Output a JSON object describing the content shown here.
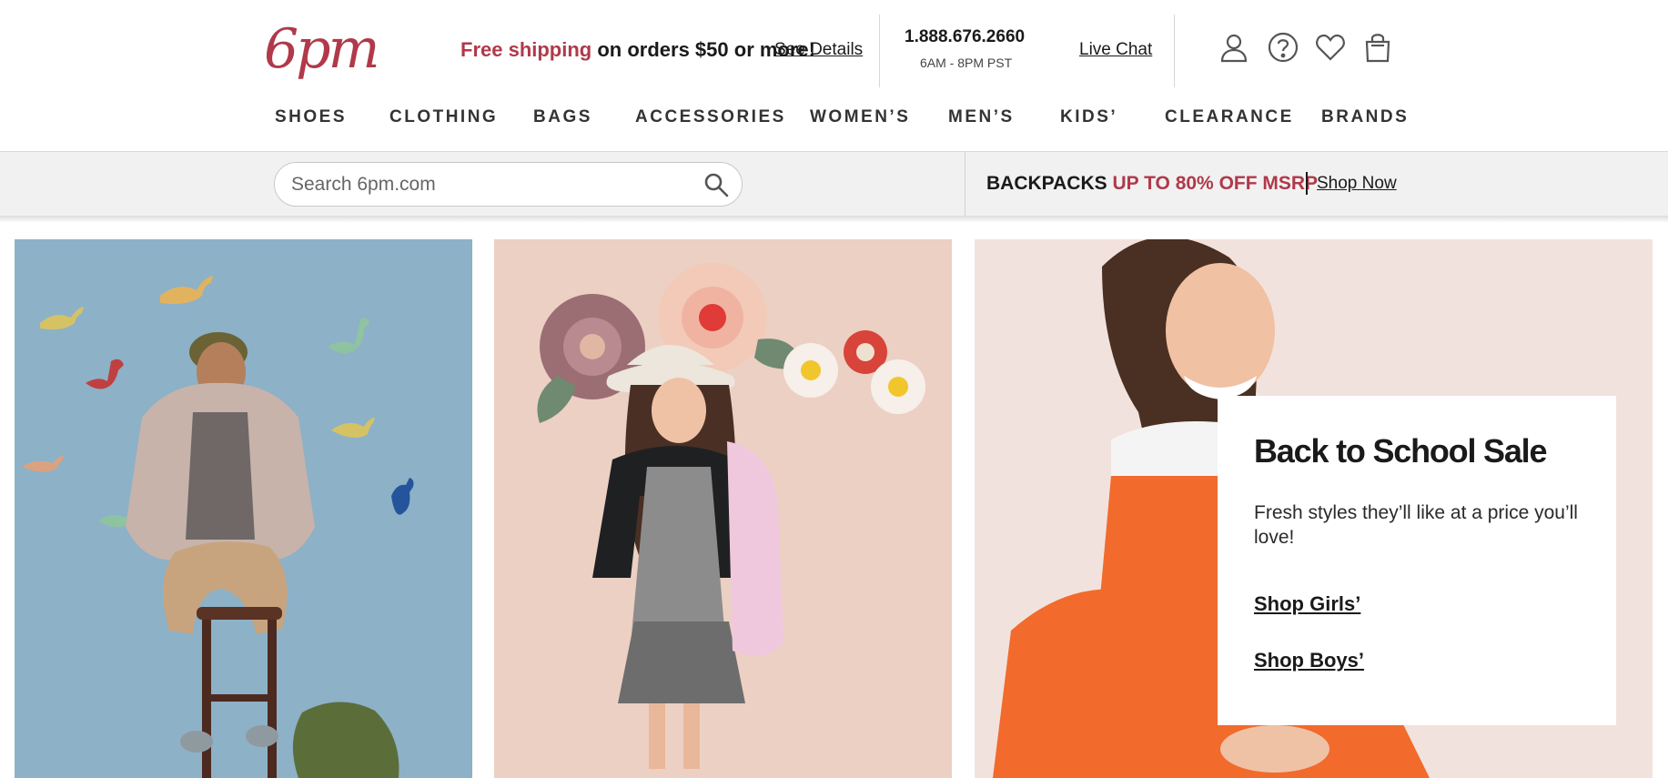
{
  "header": {
    "logo_text": "6pm",
    "shipping_highlight": "Free shipping",
    "shipping_rest": " on orders $50 or more!",
    "see_details": "See Details",
    "phone": "1.888.676.2660",
    "hours": "6AM - 8PM PST",
    "live_chat": "Live Chat",
    "icons": [
      "account-icon",
      "help-icon",
      "favorites-heart-icon",
      "shopping-bag-icon"
    ]
  },
  "nav": {
    "items": [
      "SHOES",
      "CLOTHING",
      "BAGS",
      "ACCESSORIES",
      "WOMEN’S",
      "MEN’S",
      "KIDS’",
      "CLEARANCE",
      "BRANDS"
    ]
  },
  "search": {
    "placeholder": "Search 6pm.com",
    "icon": "search-icon"
  },
  "promo": {
    "bold": "BACKPACKS ",
    "accent": "UP TO 80% OFF MSRP",
    "shop_now": "Shop Now"
  },
  "hero": {
    "card": {
      "title": "Back to School Sale",
      "text": "Fresh styles they’ll like at a price you’ll love!",
      "links": [
        "Shop Girls’",
        "Shop Boys’"
      ]
    }
  },
  "colors": {
    "brand": "#b0394a",
    "text": "#1a1a1a",
    "band": "#f1f1f1"
  }
}
